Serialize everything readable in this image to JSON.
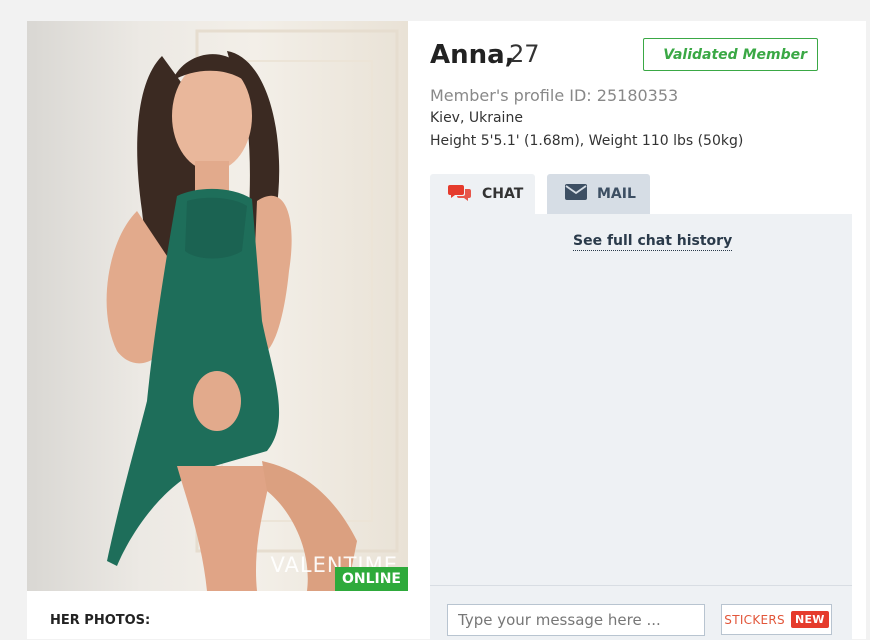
{
  "profile": {
    "name": "Anna,",
    "age": "27",
    "validated_badge": "Validated Member",
    "profile_id": "Member's profile ID: 25180353",
    "location": "Kiev, Ukraine",
    "stats": "Height 5'5.1' (1.68m), Weight 110 lbs (50kg)"
  },
  "photo": {
    "watermark": "VALENTIME",
    "online_label": "ONLINE"
  },
  "photos_section": {
    "title": "HER PHOTOS:"
  },
  "tabs": [
    {
      "label": "CHAT",
      "icon": "chat-bubbles-icon",
      "active": true
    },
    {
      "label": "MAIL",
      "icon": "envelope-icon",
      "active": false
    }
  ],
  "chat": {
    "history_link": "See full chat history",
    "input_placeholder": "Type your message here ...",
    "stickers_label": "STICKERS",
    "new_badge": "NEW"
  },
  "colors": {
    "accent_green": "#3aa845",
    "online_green": "#2eaa3b",
    "chat_red": "#e53b2c",
    "tab_inactive": "#d6dde5",
    "panel_bg": "#eef1f4"
  }
}
